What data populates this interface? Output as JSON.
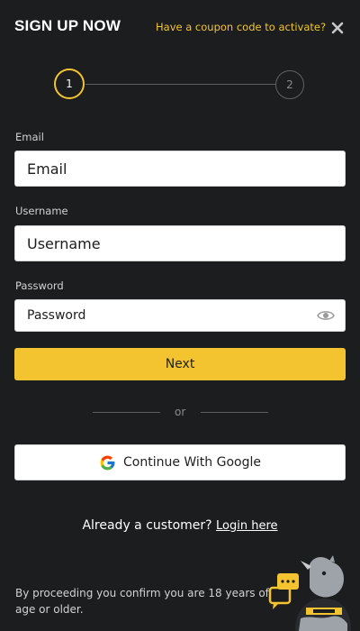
{
  "header": {
    "title": "SIGN UP NOW",
    "coupon_link": "Have a coupon code to activate?",
    "close_icon": "close-icon"
  },
  "stepper": {
    "steps": [
      "1",
      "2"
    ],
    "active_step": 1
  },
  "form": {
    "email": {
      "label": "Email",
      "placeholder": "Email",
      "value": ""
    },
    "username": {
      "label": "Username",
      "placeholder": "Username",
      "value": ""
    },
    "password": {
      "label": "Password",
      "placeholder": "Password",
      "value": "",
      "toggle_icon": "eye-icon"
    },
    "next_label": "Next"
  },
  "divider_text": "or",
  "google": {
    "label": "Continue With Google",
    "icon": "google-icon"
  },
  "footer": {
    "customer_text": "Already a customer?",
    "login_link": "Login here",
    "age_notice": "By proceeding you confirm you are 18 years of age or older."
  },
  "chat_widget": {
    "icon": "chat-mascot-icon"
  },
  "colors": {
    "background": "#1c1d1f",
    "accent": "#f4c430",
    "input_bg": "#ffffff"
  }
}
